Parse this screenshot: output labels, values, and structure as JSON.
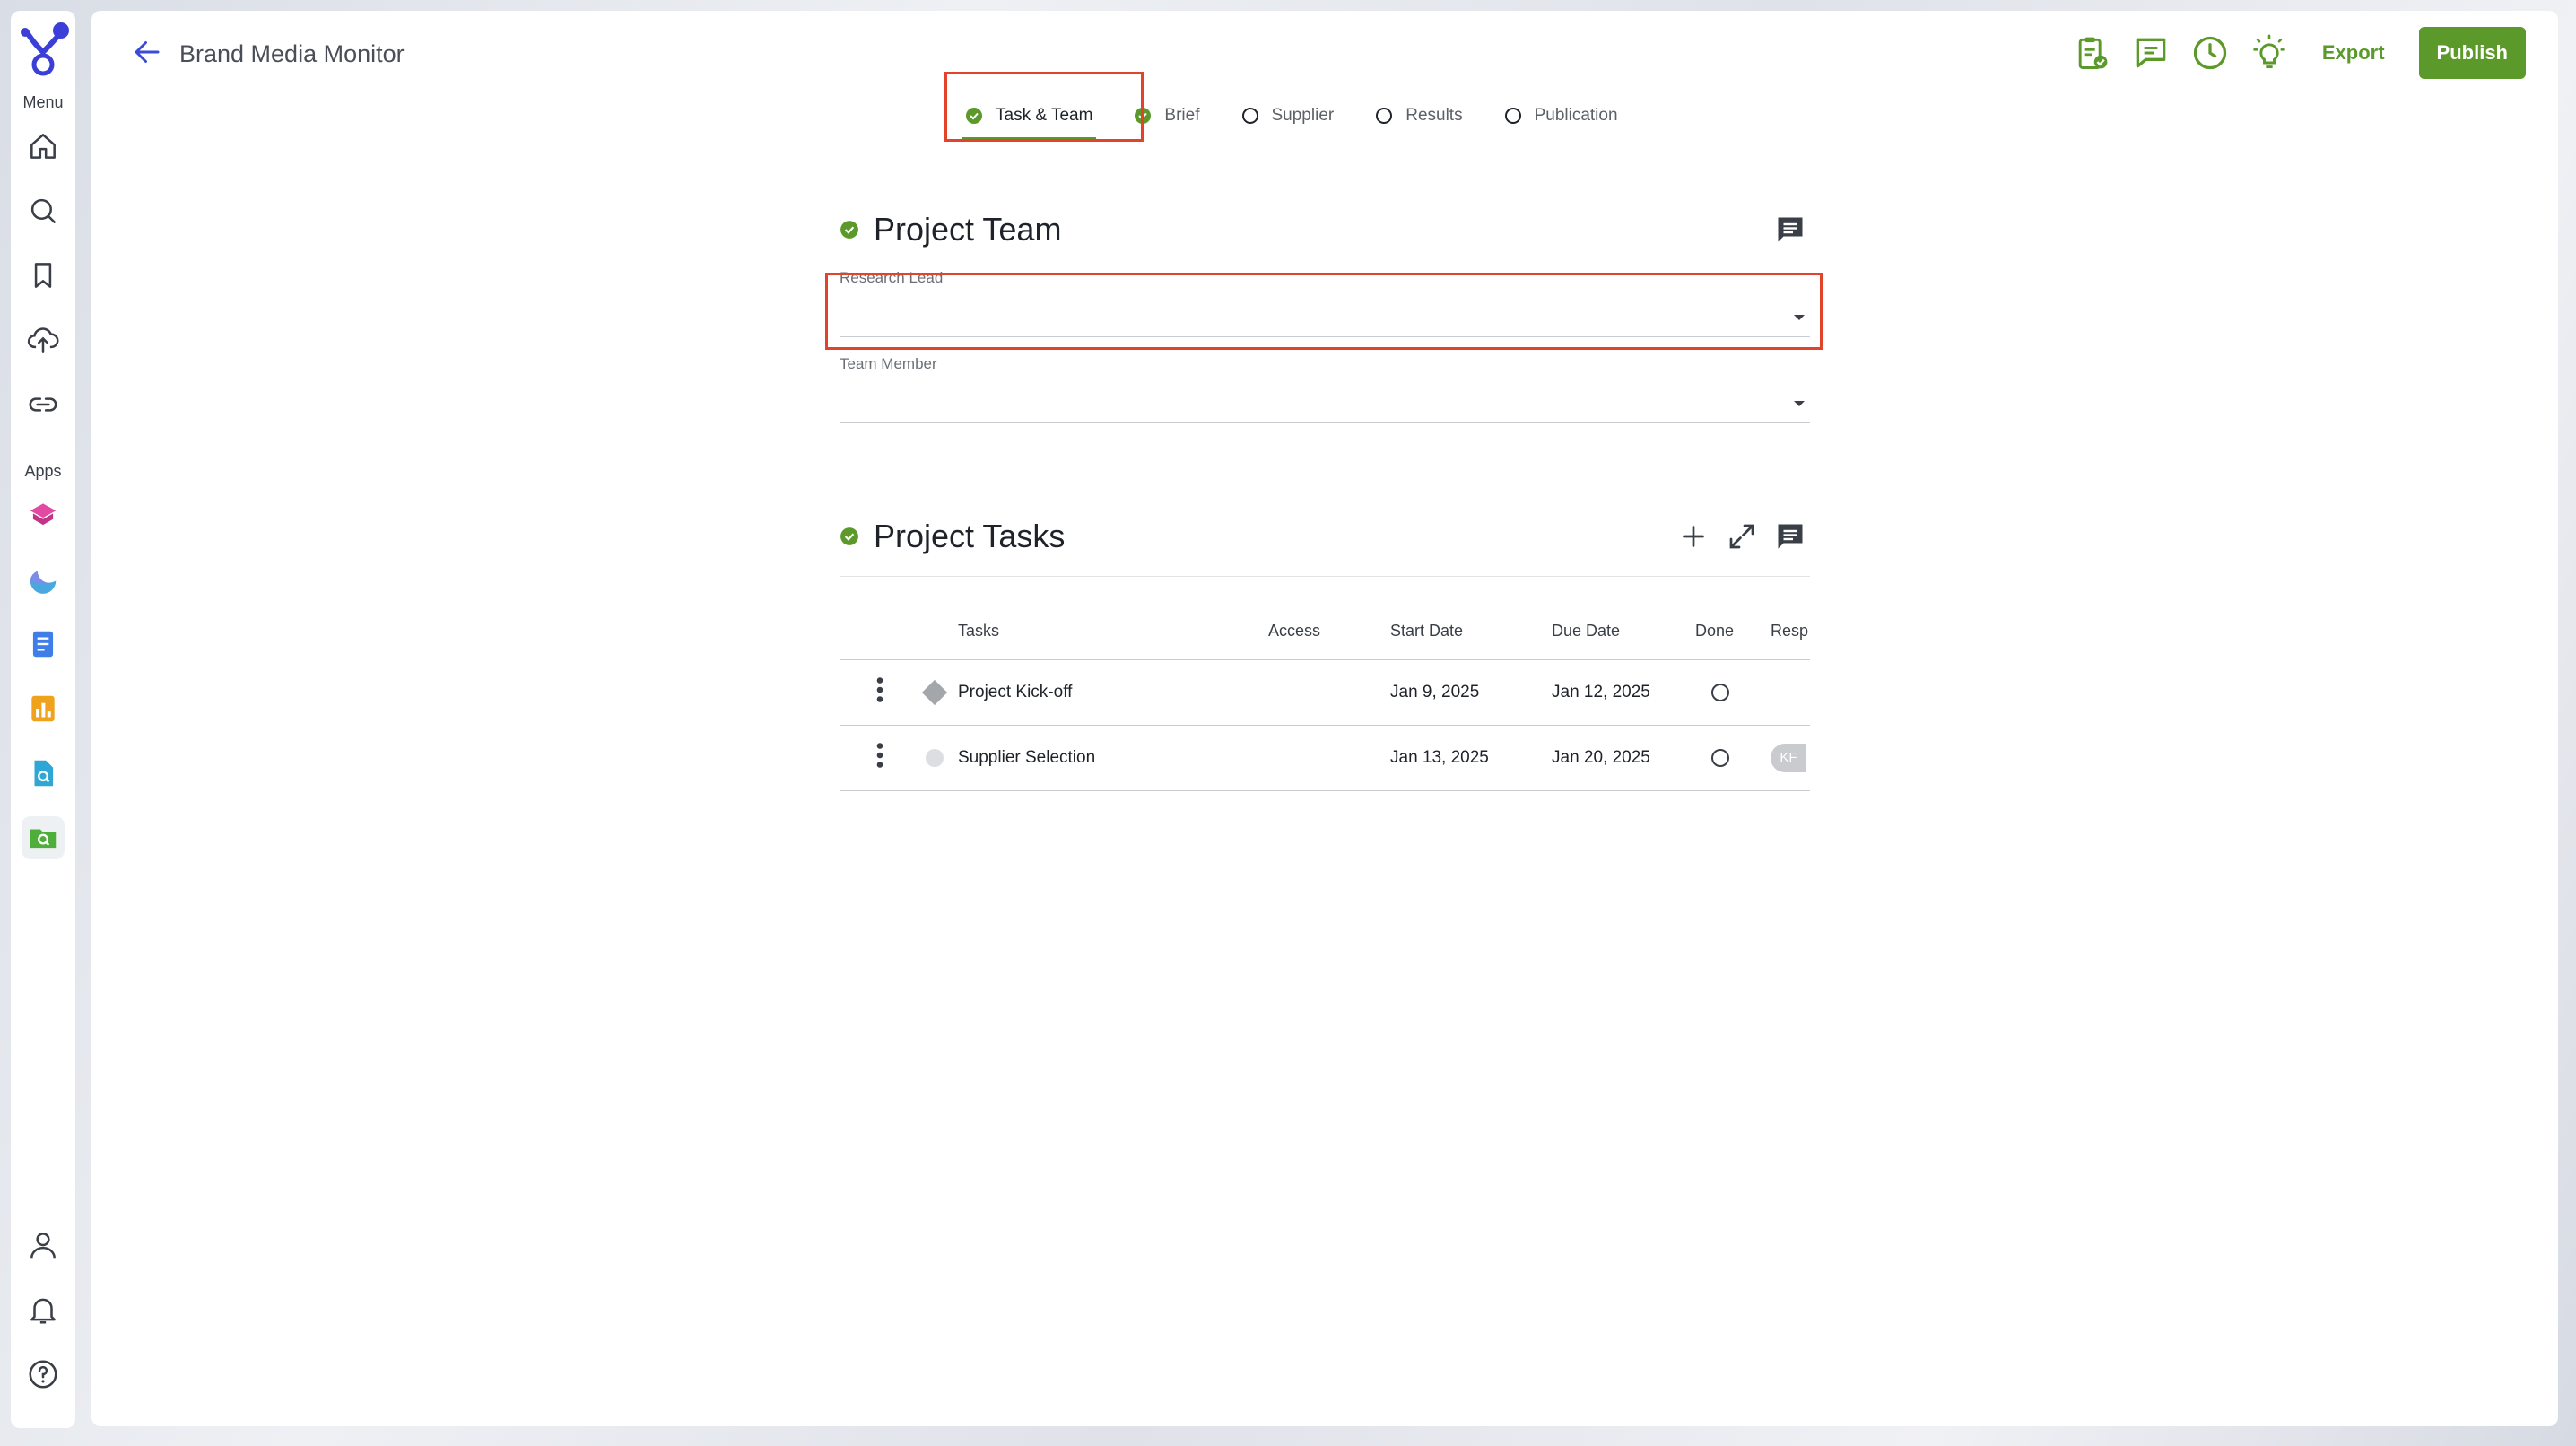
{
  "nav": {
    "menu_label": "Menu",
    "apps_label": "Apps",
    "menu_items": [
      "home-icon",
      "search-icon",
      "bookmark-icon",
      "upload-cloud-icon",
      "link-icon"
    ],
    "app_items": [
      "box-app-icon",
      "wave-app-icon",
      "document-app-icon",
      "chart-app-icon",
      "file-search-app-icon",
      "folder-search-app-icon"
    ],
    "bottom_items": [
      "user-icon",
      "bell-icon",
      "help-icon"
    ]
  },
  "header": {
    "title": "Brand Media Monitor",
    "export_label": "Export",
    "publish_label": "Publish",
    "accent_color": "#5b9a2a"
  },
  "tabs": [
    {
      "label": "Task & Team",
      "status": "complete",
      "active": true
    },
    {
      "label": "Brief",
      "status": "complete",
      "active": false
    },
    {
      "label": "Supplier",
      "status": "pending",
      "active": false
    },
    {
      "label": "Results",
      "status": "pending",
      "active": false
    },
    {
      "label": "Publication",
      "status": "pending",
      "active": false
    }
  ],
  "team": {
    "title": "Project Team",
    "fields": [
      {
        "label": "Research Lead",
        "value": ""
      },
      {
        "label": "Team Member",
        "value": ""
      }
    ]
  },
  "tasks": {
    "title": "Project Tasks",
    "columns": [
      "Tasks",
      "Access",
      "Start Date",
      "Due Date",
      "Done",
      "Resp"
    ],
    "rows": [
      {
        "name": "Project Kick-off",
        "access": "",
        "start": "Jan 9, 2025",
        "due": "Jan 12, 2025",
        "resp": ""
      },
      {
        "name": "Supplier Selection",
        "access": "",
        "start": "Jan 13, 2025",
        "due": "Jan 20, 2025",
        "resp": "KF"
      }
    ]
  }
}
